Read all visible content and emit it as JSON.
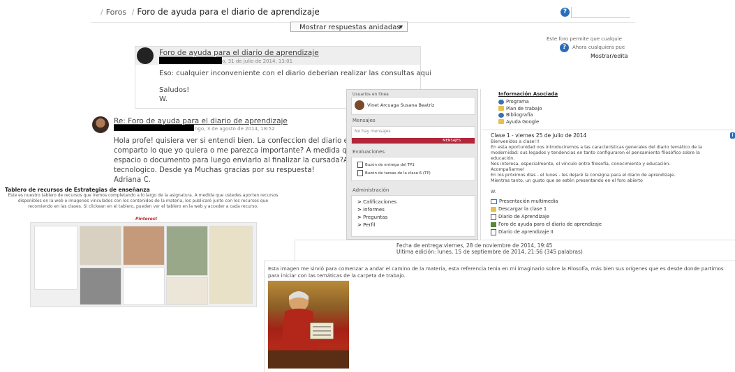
{
  "breadcrumb": {
    "foros": "Foros",
    "current": "Foro de ayuda para el diario de aprendizaje"
  },
  "help_icon": "?",
  "display_select": "Mostrar respuestas anidadas",
  "side_notes": {
    "line1": "Este foro permite que cualquie",
    "line2": "Ahora cualquiera pue",
    "edit": "Mostrar/edita"
  },
  "post1": {
    "title": "Foro de ayuda para el diario de aprendizaje",
    "meta": "o, 31 de julio de 2014, 13:01",
    "text": "Eso: cualquier inconveniente con el diario deberian realizar las consultas aqui",
    "saludos": "Saludos!",
    "signature": "W."
  },
  "post2": {
    "title": "Re: Foro de ayuda para el diario de aprendizaje",
    "meta": "ngo, 3 de agosto de 2014, 18:52",
    "lines": [
      "Hola profe! quisiera ver si entendi bien. La confeccion del diario en for",
      "comparto lo que yo quiera o me parezca importante? A medida que y",
      "espacio o documento para luego enviarlo al finalizar la cursada?A lo r",
      "tecnologico. Desde ya Muchas gracias por su respuesta!",
      "Adriana C."
    ]
  },
  "pinterest": {
    "title": "Tablero de recursos de Estrategias de enseñanza",
    "desc": "Este es nuestro tablero de recursos que iremos completando a lo largo de la asignatura. A medida que ustedes aporten recursos disponibles en la web o imagenes vinculados con los contenidos de la materia, los publicaré junto con los recursos que recomiendo en las clases. Si clickean en el tablero, pueden ver el tablero en la web y acceder a cada recurso.",
    "logo": "Pinterest"
  },
  "side_panel": {
    "users_head": "Usuarios en línea",
    "user_name": "Vinet Arcuaga Susana Beatriz",
    "messages_head": "Mensajes",
    "no_messages": "No hay mensajes",
    "messages_btn": "MENSAJES",
    "evaluaciones_head": "Evaluaciones",
    "eval_items": [
      "Buzón de entrega del TP1",
      "Buzón de tareas de la clase 6 (TP)"
    ],
    "admin_head": "Administración",
    "admin_items": [
      "Calificaciones",
      "Informes",
      "Preguntas",
      "Perfil"
    ]
  },
  "info": {
    "heading": "Información Asociada",
    "links": [
      {
        "label": "Programa",
        "icon": "globe-icon"
      },
      {
        "label": "Plan de trabajo",
        "icon": "folder-icon"
      },
      {
        "label": "Bibliografía",
        "icon": "globe-icon"
      },
      {
        "label": "Ayuda Google",
        "icon": "folder-icon"
      }
    ],
    "clase_title": "Clase 1 - viernes 25 de julio de 2014",
    "clase_lines": [
      "Bienvenidos a clase!!!",
      "En esta oportunidad nos introduciremos a las características generales del diario temático de la",
      "modernidad: sus legados y tendencias en tanto configuraron el pensamiento filosófico sobre la",
      "educación.",
      "Nos interesa, especialmente, el vínculo entre filosofía, conocimiento y educación.",
      "Acompañarme!",
      "En los próximos días - el lunes - les dejaré la consigna para el diario de aprendizaje.",
      "Mientras tanto, un gusto que se estén presentando en el foro abierto",
      "",
      "W."
    ],
    "resources": [
      {
        "label": "Presentación multimedia",
        "icon": "monitor-icon"
      },
      {
        "label": "Descargar la clase 1",
        "icon": "folder-icon"
      },
      {
        "label": "Diario de Aprendizaje",
        "icon": "doc-icon"
      },
      {
        "label": "Foro de ayuda para el diario de aprendizaje",
        "icon": "forum-icon"
      },
      {
        "label": "Diario de aprendizaje II",
        "icon": "doc-icon"
      }
    ]
  },
  "submission": {
    "fecha": "Fecha de entrega:viernes, 28 de noviembre de 2014, 19:45",
    "edicion": "Ultima edición:      lunes, 15 de septiembre de 2014, 21:56 (345 palabras)"
  },
  "bottom_text": "Esta imagen me sirvió para comenzar a andar el camino de la materia, esta referencia tenia en mi imaginario sobre la Filosofía, más bien sus orígenes que es desde donde partimos para iniciar con las temáticas de la carpeta de trabajo."
}
